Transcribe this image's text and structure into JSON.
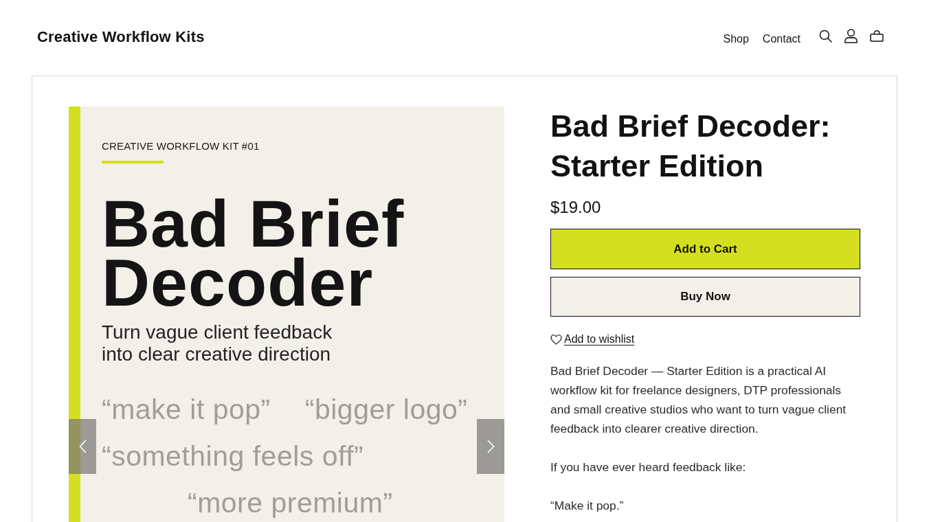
{
  "header": {
    "logo": "Creative Workflow Kits",
    "nav": [
      {
        "label": "Shop"
      },
      {
        "label": "Contact"
      }
    ]
  },
  "cover": {
    "eyebrow": "CREATIVE WORKFLOW KIT #01",
    "title": "Bad Brief Decoder",
    "subtitle": "Turn vague client feedback into clear creative direction",
    "quotes": [
      "“make it pop”",
      "“bigger logo”",
      "“something feels off”",
      "“more premium”"
    ]
  },
  "product": {
    "title": "Bad Brief Decoder: Starter Edition",
    "price": "$19.00",
    "buttons": [
      {
        "label": "Add to Cart",
        "kind": "primary"
      },
      {
        "label": "Buy Now",
        "kind": "secondary"
      }
    ],
    "wishlist": "Add to wishlist",
    "description": [
      "Bad Brief Decoder — Starter Edition is a practical AI workflow kit for freelance designers, DTP professionals and small creative studios who want to turn vague client feedback into clearer creative direction.",
      "If you have ever heard feedback like:",
      "“Make it pop.”"
    ]
  }
}
